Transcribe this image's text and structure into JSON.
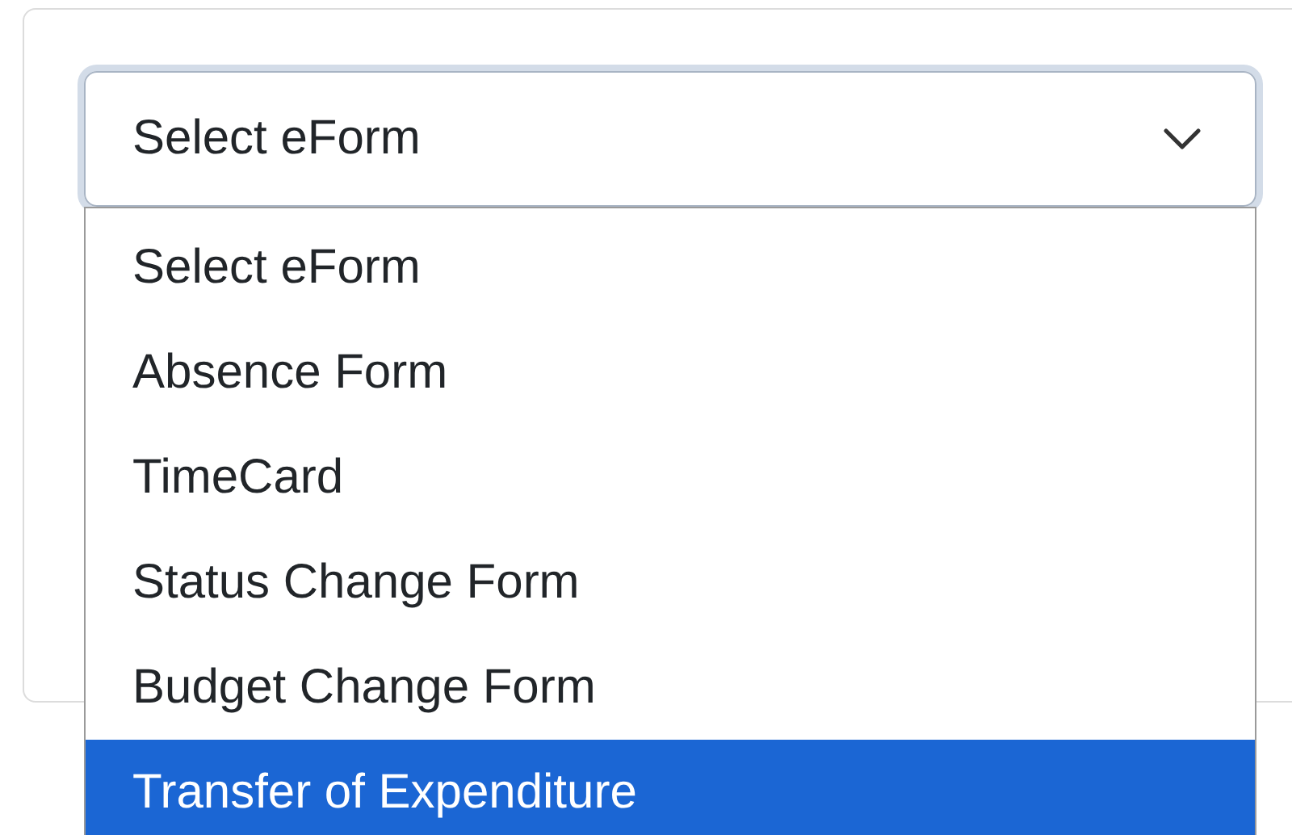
{
  "select": {
    "value": "Select eForm",
    "expanded": true
  },
  "options": [
    {
      "label": "Select eForm",
      "selected": false
    },
    {
      "label": "Absence Form",
      "selected": false
    },
    {
      "label": "TimeCard",
      "selected": false
    },
    {
      "label": "Status Change Form",
      "selected": false
    },
    {
      "label": "Budget Change Form",
      "selected": false
    },
    {
      "label": "Transfer of Expenditure",
      "selected": true
    }
  ]
}
